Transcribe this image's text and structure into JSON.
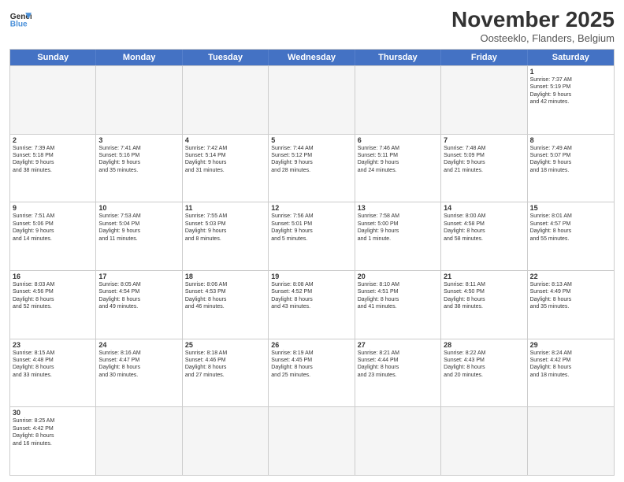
{
  "logo": {
    "text_general": "General",
    "text_blue": "Blue"
  },
  "title": "November 2025",
  "subtitle": "Oosteeklo, Flanders, Belgium",
  "days_of_week": [
    "Sunday",
    "Monday",
    "Tuesday",
    "Wednesday",
    "Thursday",
    "Friday",
    "Saturday"
  ],
  "weeks": [
    [
      {
        "day": "",
        "info": "",
        "empty": true
      },
      {
        "day": "",
        "info": "",
        "empty": true
      },
      {
        "day": "",
        "info": "",
        "empty": true
      },
      {
        "day": "",
        "info": "",
        "empty": true
      },
      {
        "day": "",
        "info": "",
        "empty": true
      },
      {
        "day": "",
        "info": "",
        "empty": true
      },
      {
        "day": "1",
        "info": "Sunrise: 7:37 AM\nSunset: 5:19 PM\nDaylight: 9 hours\nand 42 minutes.",
        "empty": false
      }
    ],
    [
      {
        "day": "2",
        "info": "Sunrise: 7:39 AM\nSunset: 5:18 PM\nDaylight: 9 hours\nand 38 minutes.",
        "empty": false
      },
      {
        "day": "3",
        "info": "Sunrise: 7:41 AM\nSunset: 5:16 PM\nDaylight: 9 hours\nand 35 minutes.",
        "empty": false
      },
      {
        "day": "4",
        "info": "Sunrise: 7:42 AM\nSunset: 5:14 PM\nDaylight: 9 hours\nand 31 minutes.",
        "empty": false
      },
      {
        "day": "5",
        "info": "Sunrise: 7:44 AM\nSunset: 5:12 PM\nDaylight: 9 hours\nand 28 minutes.",
        "empty": false
      },
      {
        "day": "6",
        "info": "Sunrise: 7:46 AM\nSunset: 5:11 PM\nDaylight: 9 hours\nand 24 minutes.",
        "empty": false
      },
      {
        "day": "7",
        "info": "Sunrise: 7:48 AM\nSunset: 5:09 PM\nDaylight: 9 hours\nand 21 minutes.",
        "empty": false
      },
      {
        "day": "8",
        "info": "Sunrise: 7:49 AM\nSunset: 5:07 PM\nDaylight: 9 hours\nand 18 minutes.",
        "empty": false
      }
    ],
    [
      {
        "day": "9",
        "info": "Sunrise: 7:51 AM\nSunset: 5:06 PM\nDaylight: 9 hours\nand 14 minutes.",
        "empty": false
      },
      {
        "day": "10",
        "info": "Sunrise: 7:53 AM\nSunset: 5:04 PM\nDaylight: 9 hours\nand 11 minutes.",
        "empty": false
      },
      {
        "day": "11",
        "info": "Sunrise: 7:55 AM\nSunset: 5:03 PM\nDaylight: 9 hours\nand 8 minutes.",
        "empty": false
      },
      {
        "day": "12",
        "info": "Sunrise: 7:56 AM\nSunset: 5:01 PM\nDaylight: 9 hours\nand 5 minutes.",
        "empty": false
      },
      {
        "day": "13",
        "info": "Sunrise: 7:58 AM\nSunset: 5:00 PM\nDaylight: 9 hours\nand 1 minute.",
        "empty": false
      },
      {
        "day": "14",
        "info": "Sunrise: 8:00 AM\nSunset: 4:58 PM\nDaylight: 8 hours\nand 58 minutes.",
        "empty": false
      },
      {
        "day": "15",
        "info": "Sunrise: 8:01 AM\nSunset: 4:57 PM\nDaylight: 8 hours\nand 55 minutes.",
        "empty": false
      }
    ],
    [
      {
        "day": "16",
        "info": "Sunrise: 8:03 AM\nSunset: 4:56 PM\nDaylight: 8 hours\nand 52 minutes.",
        "empty": false
      },
      {
        "day": "17",
        "info": "Sunrise: 8:05 AM\nSunset: 4:54 PM\nDaylight: 8 hours\nand 49 minutes.",
        "empty": false
      },
      {
        "day": "18",
        "info": "Sunrise: 8:06 AM\nSunset: 4:53 PM\nDaylight: 8 hours\nand 46 minutes.",
        "empty": false
      },
      {
        "day": "19",
        "info": "Sunrise: 8:08 AM\nSunset: 4:52 PM\nDaylight: 8 hours\nand 43 minutes.",
        "empty": false
      },
      {
        "day": "20",
        "info": "Sunrise: 8:10 AM\nSunset: 4:51 PM\nDaylight: 8 hours\nand 41 minutes.",
        "empty": false
      },
      {
        "day": "21",
        "info": "Sunrise: 8:11 AM\nSunset: 4:50 PM\nDaylight: 8 hours\nand 38 minutes.",
        "empty": false
      },
      {
        "day": "22",
        "info": "Sunrise: 8:13 AM\nSunset: 4:49 PM\nDaylight: 8 hours\nand 35 minutes.",
        "empty": false
      }
    ],
    [
      {
        "day": "23",
        "info": "Sunrise: 8:15 AM\nSunset: 4:48 PM\nDaylight: 8 hours\nand 33 minutes.",
        "empty": false
      },
      {
        "day": "24",
        "info": "Sunrise: 8:16 AM\nSunset: 4:47 PM\nDaylight: 8 hours\nand 30 minutes.",
        "empty": false
      },
      {
        "day": "25",
        "info": "Sunrise: 8:18 AM\nSunset: 4:46 PM\nDaylight: 8 hours\nand 27 minutes.",
        "empty": false
      },
      {
        "day": "26",
        "info": "Sunrise: 8:19 AM\nSunset: 4:45 PM\nDaylight: 8 hours\nand 25 minutes.",
        "empty": false
      },
      {
        "day": "27",
        "info": "Sunrise: 8:21 AM\nSunset: 4:44 PM\nDaylight: 8 hours\nand 23 minutes.",
        "empty": false
      },
      {
        "day": "28",
        "info": "Sunrise: 8:22 AM\nSunset: 4:43 PM\nDaylight: 8 hours\nand 20 minutes.",
        "empty": false
      },
      {
        "day": "29",
        "info": "Sunrise: 8:24 AM\nSunset: 4:42 PM\nDaylight: 8 hours\nand 18 minutes.",
        "empty": false
      }
    ],
    [
      {
        "day": "30",
        "info": "Sunrise: 8:25 AM\nSunset: 4:42 PM\nDaylight: 8 hours\nand 16 minutes.",
        "empty": false
      },
      {
        "day": "",
        "info": "",
        "empty": true
      },
      {
        "day": "",
        "info": "",
        "empty": true
      },
      {
        "day": "",
        "info": "",
        "empty": true
      },
      {
        "day": "",
        "info": "",
        "empty": true
      },
      {
        "day": "",
        "info": "",
        "empty": true
      },
      {
        "day": "",
        "info": "",
        "empty": true
      }
    ]
  ]
}
